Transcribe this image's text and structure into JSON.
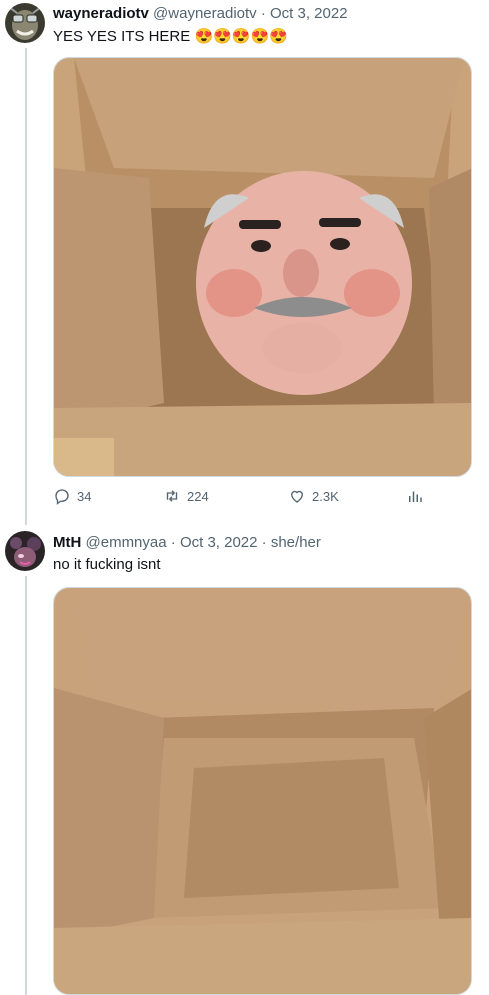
{
  "tweet1": {
    "name": "wayneradiotv",
    "handle": "@wayneradiotv",
    "dot": "·",
    "date": "Oct 3, 2022",
    "text": "YES YES ITS HERE",
    "emojis": [
      "😍",
      "😍",
      "😍",
      "😍",
      "😍"
    ],
    "image_alt": "cardboard box with a face inside",
    "stats": {
      "replies": "34",
      "retweets": "224",
      "likes": "2.3K"
    }
  },
  "tweet2": {
    "name": "MtH",
    "handle": "@emmnyaa",
    "dot": "·",
    "date": "Oct 3, 2022",
    "dot2": "·",
    "pronouns": "she/her",
    "text": "no it fucking isnt",
    "image_alt": "empty cardboard box"
  },
  "icons": {
    "reply": "reply-icon",
    "retweet": "retweet-icon",
    "like": "like-icon",
    "analytics": "analytics-icon"
  },
  "colors": {
    "muted": "#536471",
    "text": "#0f1419",
    "thread": "#cfd9de",
    "cardboard": "#b48d63"
  }
}
